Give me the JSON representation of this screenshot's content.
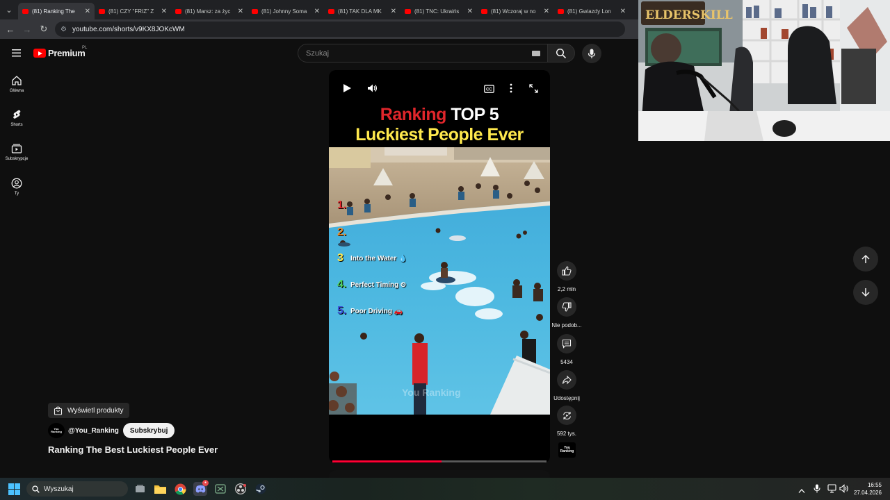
{
  "browser": {
    "tabs": [
      {
        "label": "(81) Ranking The",
        "active": true
      },
      {
        "label": "(81) CZY \"FRIZ\" Z"
      },
      {
        "label": "(81) Marsz: za życ"
      },
      {
        "label": "(81) Johnny Soma"
      },
      {
        "label": "(81) TAK DLA MK"
      },
      {
        "label": "(81) TNC: Ukraińs"
      },
      {
        "label": "(81) Wczoraj w no"
      },
      {
        "label": "(81) Gwiazdy Lon"
      }
    ],
    "url": "youtube.com/shorts/v9KX8JOKcWM"
  },
  "youtube": {
    "logo_word": "Premium",
    "logo_region": "PL",
    "search_placeholder": "Szukaj",
    "sidebar": [
      {
        "label": "Główna",
        "icon": "home-icon"
      },
      {
        "label": "Shorts",
        "icon": "shorts-icon"
      },
      {
        "label": "Subskrypcje",
        "icon": "subscriptions-icon"
      },
      {
        "label": "Ty",
        "icon": "you-icon"
      }
    ]
  },
  "short": {
    "title_red": "Ranking",
    "title_white": "TOP 5",
    "title_yellow": "Luckiest People Ever",
    "ranks": [
      {
        "num": "1.",
        "text": ""
      },
      {
        "num": "2.",
        "text": ""
      },
      {
        "num": "3",
        "text": "Into the Water 💧"
      },
      {
        "num": "4.",
        "text": "Perfect Timing ⏲"
      },
      {
        "num": "5.",
        "text": "Poor Driving 🚗"
      }
    ],
    "watermark": "You Ranking",
    "progress": 0.51,
    "actions": {
      "likes": "2,2 mln",
      "dislike_label": "Nie podob...",
      "comments": "5434",
      "share_label": "Udostępnij",
      "remix_count": "592 tys."
    },
    "products_label": "Wyświetl produkty",
    "channel": "@You_Ranking",
    "avatar_text": "You Ranking",
    "subscribe_label": "Subskrybuj",
    "video_title": "Ranking The Best Luckiest People Ever"
  },
  "webcam": {
    "overlay_text": "ELDERSKILL"
  },
  "taskbar": {
    "search_label": "Wyszukaj",
    "time": "16:55",
    "date": "27.04.2026"
  }
}
